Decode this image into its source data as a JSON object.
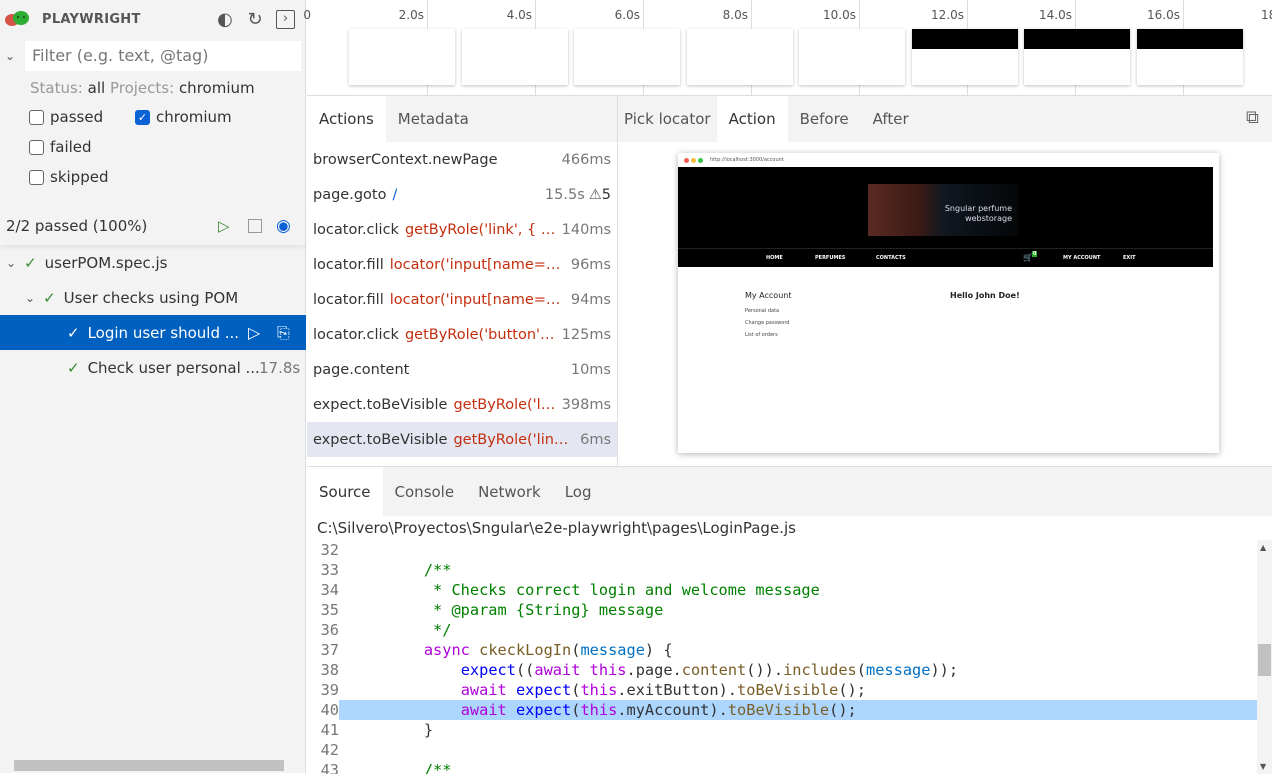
{
  "app": {
    "title": "PLAYWRIGHT",
    "icons": [
      "theme-toggle-icon",
      "reload-icon",
      "expand-panel-icon"
    ]
  },
  "filter": {
    "placeholder": "Filter (e.g. text, @tag)",
    "status_label": "Status:",
    "status_value": "all",
    "projects_label": "Projects:",
    "projects_value": "chromium",
    "checkboxes": [
      {
        "label": "passed",
        "checked": false
      },
      {
        "label": "failed",
        "checked": false
      },
      {
        "label": "skipped",
        "checked": false
      },
      {
        "label": "chromium",
        "checked": true
      }
    ]
  },
  "summary": {
    "text": "2/2 passed (100%)"
  },
  "tree": [
    {
      "label": "userPOM.spec.js",
      "level": 0,
      "expanded": true
    },
    {
      "label": "User checks using POM",
      "level": 1,
      "expanded": true
    },
    {
      "label": "Login user should ...",
      "level": 2,
      "selected": true
    },
    {
      "label": "Check user personal ...",
      "level": 2,
      "duration": "17.8s"
    }
  ],
  "timeline": {
    "ticks": [
      "0",
      "2.0s",
      "4.0s",
      "6.0s",
      "8.0s",
      "10.0s",
      "12.0s",
      "14.0s",
      "16.0s",
      "18."
    ]
  },
  "actions_tabs": [
    "Actions",
    "Metadata"
  ],
  "actions": [
    {
      "name": "browserContext.newPage",
      "selector": "",
      "duration": "466ms"
    },
    {
      "name": "page.goto",
      "selector": "/",
      "duration": "15.5s",
      "warnings": "5"
    },
    {
      "name": "locator.click",
      "selector": "getByRole('link', { na...",
      "duration": "140ms"
    },
    {
      "name": "locator.fill",
      "selector": "locator('input[name=\"e...",
      "duration": "96ms"
    },
    {
      "name": "locator.fill",
      "selector": "locator('input[name=\"p...",
      "duration": "94ms"
    },
    {
      "name": "locator.click",
      "selector": "getByRole('button', ...",
      "duration": "125ms"
    },
    {
      "name": "page.content",
      "selector": "",
      "duration": "10ms"
    },
    {
      "name": "expect.toBeVisible",
      "selector": "getByRole('lin...",
      "duration": "398ms"
    },
    {
      "name": "expect.toBeVisible",
      "selector": "getByRole('link',...",
      "duration": "6ms",
      "current": true
    }
  ],
  "snapshot_tabs": {
    "pick": "Pick locator",
    "tabs": [
      "Action",
      "Before",
      "After"
    ],
    "active": "Action"
  },
  "snapshot": {
    "url": "http://localhost:3000/account",
    "banner_line1": "Sngular perfume",
    "banner_line2": "webstorage",
    "nav": [
      "HOME",
      "PERFUMES",
      "CONTACTS"
    ],
    "cart_count": "0",
    "my_account": "MY ACCOUNT",
    "exit": "EXIT",
    "account_title": "My Account",
    "links": [
      "Personal data",
      "Change password",
      "List of orders"
    ],
    "greeting": "Hello John Doe!"
  },
  "bottom_tabs": [
    "Source",
    "Console",
    "Network",
    "Log"
  ],
  "source": {
    "path": "C:\\Silvero\\Proyectos\\Sngular\\e2e-playwright\\pages\\LoginPage.js",
    "highlight_line": 40,
    "lines": [
      {
        "n": "32",
        "t": []
      },
      {
        "n": "33",
        "t": [
          [
            "    ",
            "p"
          ],
          [
            "/**",
            "c"
          ]
        ]
      },
      {
        "n": "34",
        "t": [
          [
            "     * Checks correct login and welcome message",
            "c"
          ]
        ]
      },
      {
        "n": "35",
        "t": [
          [
            "     * @param {String} message",
            "c"
          ]
        ]
      },
      {
        "n": "36",
        "t": [
          [
            "     */",
            "c"
          ]
        ]
      },
      {
        "n": "37",
        "t": [
          [
            "    ",
            "p"
          ],
          [
            "async",
            "k"
          ],
          [
            " ",
            "p"
          ],
          [
            "ckeckLogIn",
            "f"
          ],
          [
            "(",
            "p"
          ],
          [
            "message",
            "v"
          ],
          [
            ") {",
            "p"
          ]
        ]
      },
      {
        "n": "38",
        "t": [
          [
            "        ",
            "p"
          ],
          [
            "expect",
            "e"
          ],
          [
            "((",
            "p"
          ],
          [
            "await",
            "k"
          ],
          [
            " ",
            "p"
          ],
          [
            "this",
            "k"
          ],
          [
            ".page.",
            "p"
          ],
          [
            "content",
            "f"
          ],
          [
            "()).",
            "p"
          ],
          [
            "includes",
            "f"
          ],
          [
            "(",
            "p"
          ],
          [
            "message",
            "v"
          ],
          [
            "));",
            "p"
          ]
        ]
      },
      {
        "n": "39",
        "t": [
          [
            "        ",
            "p"
          ],
          [
            "await",
            "k"
          ],
          [
            " ",
            "p"
          ],
          [
            "expect",
            "e"
          ],
          [
            "(",
            "p"
          ],
          [
            "this",
            "k"
          ],
          [
            ".exitButton).",
            "p"
          ],
          [
            "toBeVisible",
            "f"
          ],
          [
            "();",
            "p"
          ]
        ]
      },
      {
        "n": "40",
        "t": [
          [
            "        ",
            "p"
          ],
          [
            "await",
            "k"
          ],
          [
            " ",
            "p"
          ],
          [
            "expect",
            "e"
          ],
          [
            "(",
            "p"
          ],
          [
            "this",
            "k"
          ],
          [
            ".myAccount).",
            "p"
          ],
          [
            "toBeVisible",
            "f"
          ],
          [
            "();",
            "p"
          ]
        ]
      },
      {
        "n": "41",
        "t": [
          [
            "    }",
            "p"
          ]
        ]
      },
      {
        "n": "42",
        "t": []
      },
      {
        "n": "43",
        "t": [
          [
            "    ",
            "p"
          ],
          [
            "/**",
            "c"
          ]
        ]
      }
    ]
  }
}
